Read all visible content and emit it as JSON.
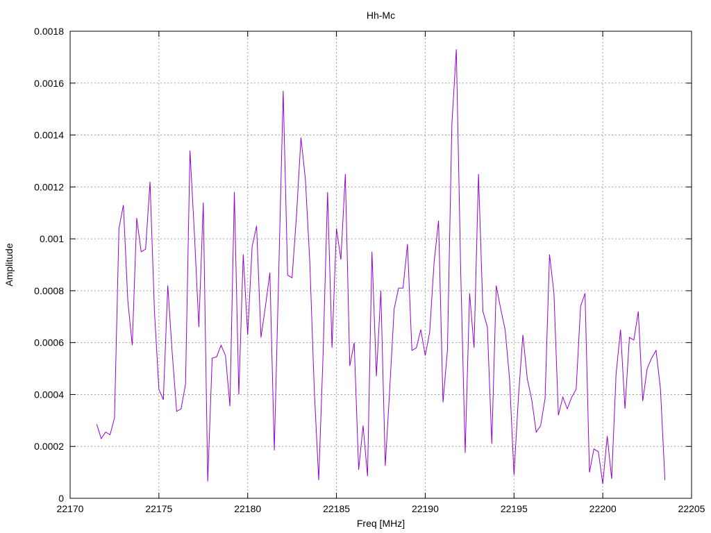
{
  "chart_data": {
    "type": "line",
    "title": "Hh-Mc",
    "xlabel": "Freq [MHz]",
    "ylabel": "Amplitude",
    "xlim": [
      22170,
      22205
    ],
    "ylim": [
      0,
      0.0018
    ],
    "grid": true,
    "x_ticks": [
      "22170",
      "22175",
      "22180",
      "22185",
      "22190",
      "22195",
      "22200",
      "22205"
    ],
    "y_ticks": [
      "0",
      "0.0002",
      "0.0004",
      "0.0006",
      "0.0008",
      "0.001",
      "0.0012",
      "0.0014",
      "0.0016",
      "0.0018"
    ],
    "series": [
      {
        "color": "#9400d3",
        "x": [
          22171.5,
          22171.75,
          22172,
          22172.25,
          22172.5,
          22172.75,
          22173,
          22173.25,
          22173.5,
          22173.75,
          22174,
          22174.25,
          22174.5,
          22174.75,
          22175,
          22175.25,
          22175.5,
          22175.75,
          22176,
          22176.25,
          22176.5,
          22176.75,
          22177,
          22177.25,
          22177.5,
          22177.75,
          22178,
          22178.25,
          22178.5,
          22178.75,
          22179,
          22179.25,
          22179.5,
          22179.75,
          22180,
          22180.25,
          22180.5,
          22180.75,
          22181,
          22181.25,
          22181.5,
          22181.75,
          22182,
          22182.25,
          22182.5,
          22182.75,
          22183,
          22183.25,
          22183.5,
          22183.75,
          22184,
          22184.25,
          22184.5,
          22184.75,
          22185,
          22185.25,
          22185.5,
          22185.75,
          22186,
          22186.25,
          22186.5,
          22186.75,
          22187,
          22187.25,
          22187.5,
          22187.75,
          22188,
          22188.25,
          22188.5,
          22188.75,
          22189,
          22189.25,
          22189.5,
          22189.75,
          22190,
          22190.25,
          22190.5,
          22190.75,
          22191,
          22191.25,
          22191.5,
          22191.75,
          22192,
          22192.25,
          22192.5,
          22192.75,
          22193,
          22193.25,
          22193.5,
          22193.75,
          22194,
          22194.25,
          22194.5,
          22194.75,
          22195,
          22195.25,
          22195.5,
          22195.75,
          22196,
          22196.25,
          22196.5,
          22196.75,
          22197,
          22197.25,
          22197.5,
          22197.75,
          22198,
          22198.25,
          22198.5,
          22198.75,
          22199,
          22199.25,
          22199.5,
          22199.75,
          22200,
          22200.25,
          22200.5,
          22200.75,
          22201,
          22201.25,
          22201.5,
          22201.75,
          22202,
          22202.25,
          22202.5,
          22202.75,
          22203,
          22203.25,
          22203.5
        ],
        "values": [
          0.000285,
          0.00023,
          0.000255,
          0.000245,
          0.00031,
          0.00104,
          0.00113,
          0.00076,
          0.00059,
          0.00108,
          0.00095,
          0.00096,
          0.00122,
          0.00072,
          0.00042,
          0.00038,
          0.00082,
          0.00056,
          0.000335,
          0.000345,
          0.00044,
          0.00134,
          0.00102,
          0.00066,
          0.00114,
          6.5e-05,
          0.00054,
          0.000545,
          0.00059,
          0.00055,
          0.000355,
          0.00118,
          0.0004,
          0.00094,
          0.00063,
          0.00097,
          0.00105,
          0.00062,
          0.00074,
          0.00087,
          0.000185,
          0.00087,
          0.00157,
          0.00086,
          0.00085,
          0.00109,
          0.00139,
          0.00123,
          0.00091,
          0.00042,
          7e-05,
          0.00056,
          0.00118,
          0.00058,
          0.00104,
          0.00092,
          0.00125,
          0.00051,
          0.0006,
          0.00011,
          0.00028,
          8.5e-05,
          0.00095,
          0.00047,
          0.0008,
          0.000125,
          0.00042,
          0.00073,
          0.00081,
          0.00081,
          0.00098,
          0.00057,
          0.00058,
          0.00065,
          0.00055,
          0.00064,
          0.00091,
          0.00107,
          0.00037,
          0.00057,
          0.00144,
          0.00173,
          0.00087,
          0.000175,
          0.00079,
          0.00058,
          0.00125,
          0.00072,
          0.00066,
          0.00021,
          0.00082,
          0.00073,
          0.00065,
          0.00046,
          9e-05,
          0.00039,
          0.00063,
          0.00046,
          0.00038,
          0.000255,
          0.00028,
          0.000385,
          0.00094,
          0.00079,
          0.00032,
          0.00039,
          0.000345,
          0.00039,
          0.00042,
          0.00074,
          0.00079,
          0.0001,
          0.00019,
          0.00018,
          5.5e-05,
          0.00024,
          7.5e-05,
          0.00048,
          0.00065,
          0.000345,
          0.00062,
          0.00061,
          0.00072,
          0.000375,
          0.0005,
          0.00054,
          0.00057,
          0.00042,
          7e-05
        ]
      }
    ]
  }
}
